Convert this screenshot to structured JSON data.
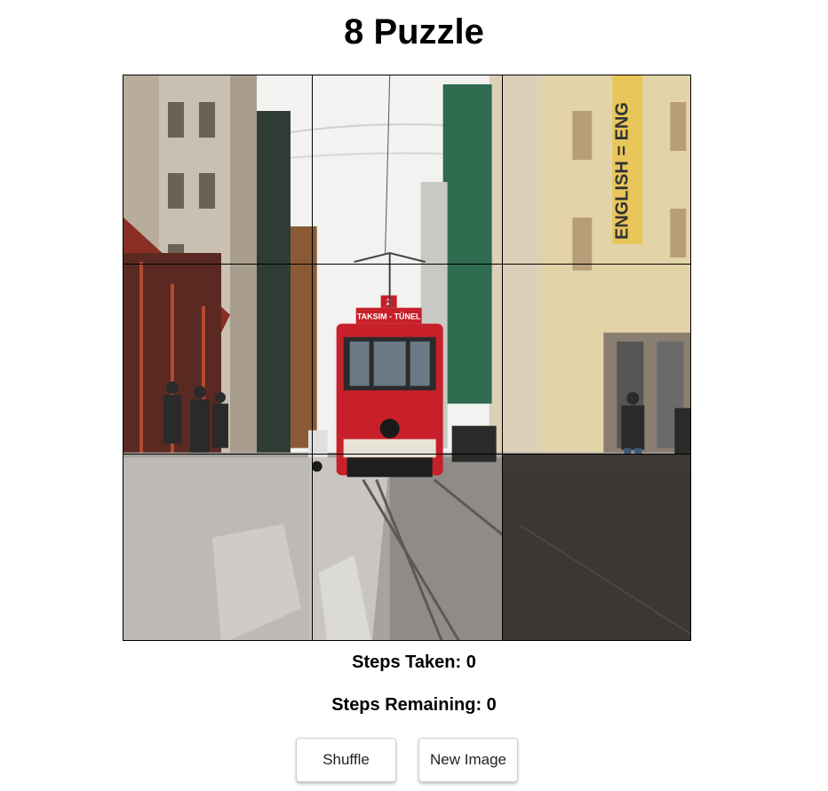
{
  "title": "8 Puzzle",
  "stats": {
    "steps_taken_label": "Steps Taken:",
    "steps_taken": "0",
    "steps_remaining_label": "Steps Remaining:",
    "steps_remaining": "0"
  },
  "buttons": {
    "shuffle": "Shuffle",
    "new_image": "New Image"
  },
  "puzzle": {
    "grid_size": 3,
    "order": [
      1,
      2,
      3,
      4,
      5,
      6,
      7,
      8,
      0
    ],
    "blank_tile": 0,
    "image_subject": "street-with-red-tram",
    "sign_text": "ENGLISH = ENG",
    "tram_sign": "TAKSIM - TÜNEL",
    "colors": {
      "tram_red": "#c8202a",
      "sky": "#f2f2f0",
      "green_scaffold": "#2e6b4f",
      "road": "#9a9894",
      "blank": "#3b3835"
    }
  }
}
